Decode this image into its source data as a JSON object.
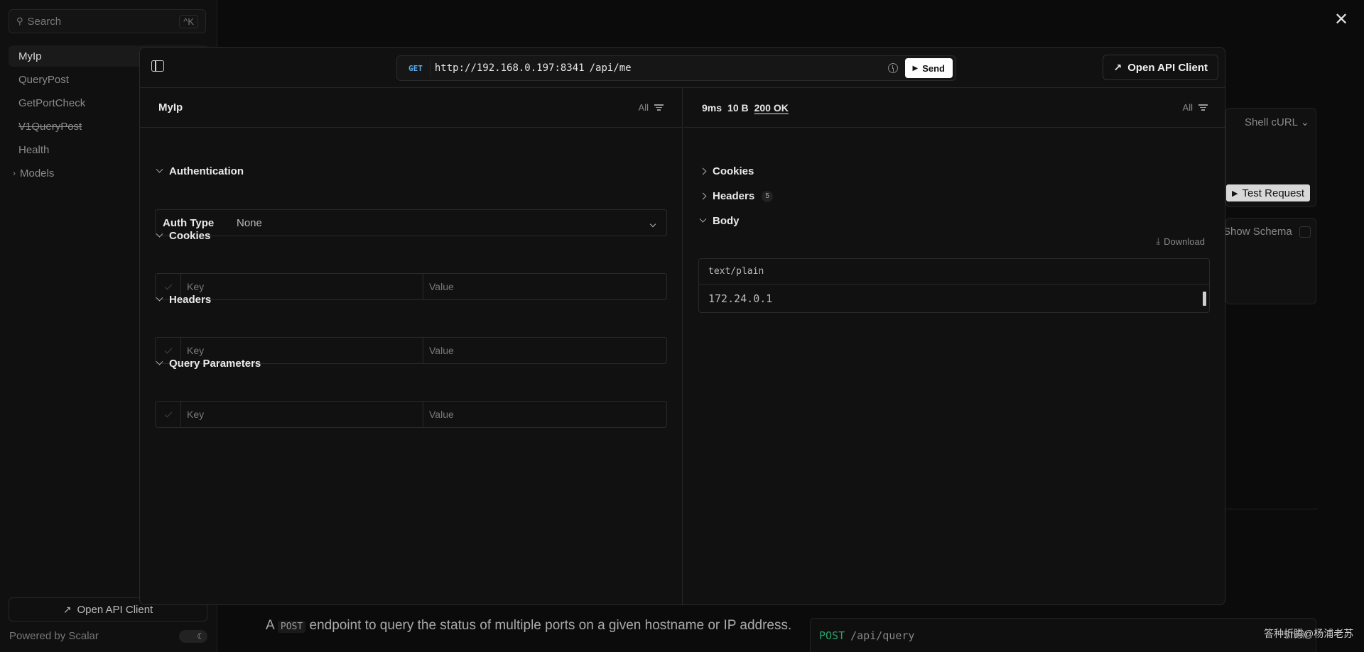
{
  "sidebar": {
    "search_placeholder": "Search",
    "search_shortcut": "^K",
    "items": [
      {
        "label": "MyIp"
      },
      {
        "label": "QueryPost"
      },
      {
        "label": "GetPortCheck"
      },
      {
        "label": "V1QueryPost"
      },
      {
        "label": "Health"
      },
      {
        "label": "Models"
      }
    ],
    "open_client_label": "Open API Client",
    "powered_by": "Powered by Scalar"
  },
  "background": {
    "shell_label": "Shell cURL",
    "test_request_label": "Test Request",
    "show_schema_label": "Show Schema",
    "description_before": "A",
    "description_code": "POST",
    "description_after": "endpoint to query the status of multiple ports on a given hostname or IP address.",
    "code_method": "POST",
    "code_path": "/api/query",
    "code_shell": "Shell",
    "watermark": "答种折腾@杨浦老苏"
  },
  "modal": {
    "method": "GET",
    "url": "http://192.168.0.197:8341",
    "path": "/api/me",
    "send_label": "Send",
    "open_client_label": "Open API Client",
    "request": {
      "title": "MyIp",
      "filter_label": "All",
      "sections": {
        "auth": "Authentication",
        "cookies": "Cookies",
        "headers": "Headers",
        "query": "Query Parameters"
      },
      "auth_type_label": "Auth Type",
      "auth_type_value": "None",
      "key_placeholder": "Key",
      "value_placeholder": "Value"
    },
    "response": {
      "time": "9ms",
      "size": "10 B",
      "status": "200 OK",
      "filter_label": "All",
      "sections": {
        "cookies": "Cookies",
        "headers": "Headers",
        "headers_count": "5",
        "body": "Body"
      },
      "download_label": "Download",
      "content_type": "text/plain",
      "body": "172.24.0.1"
    }
  }
}
